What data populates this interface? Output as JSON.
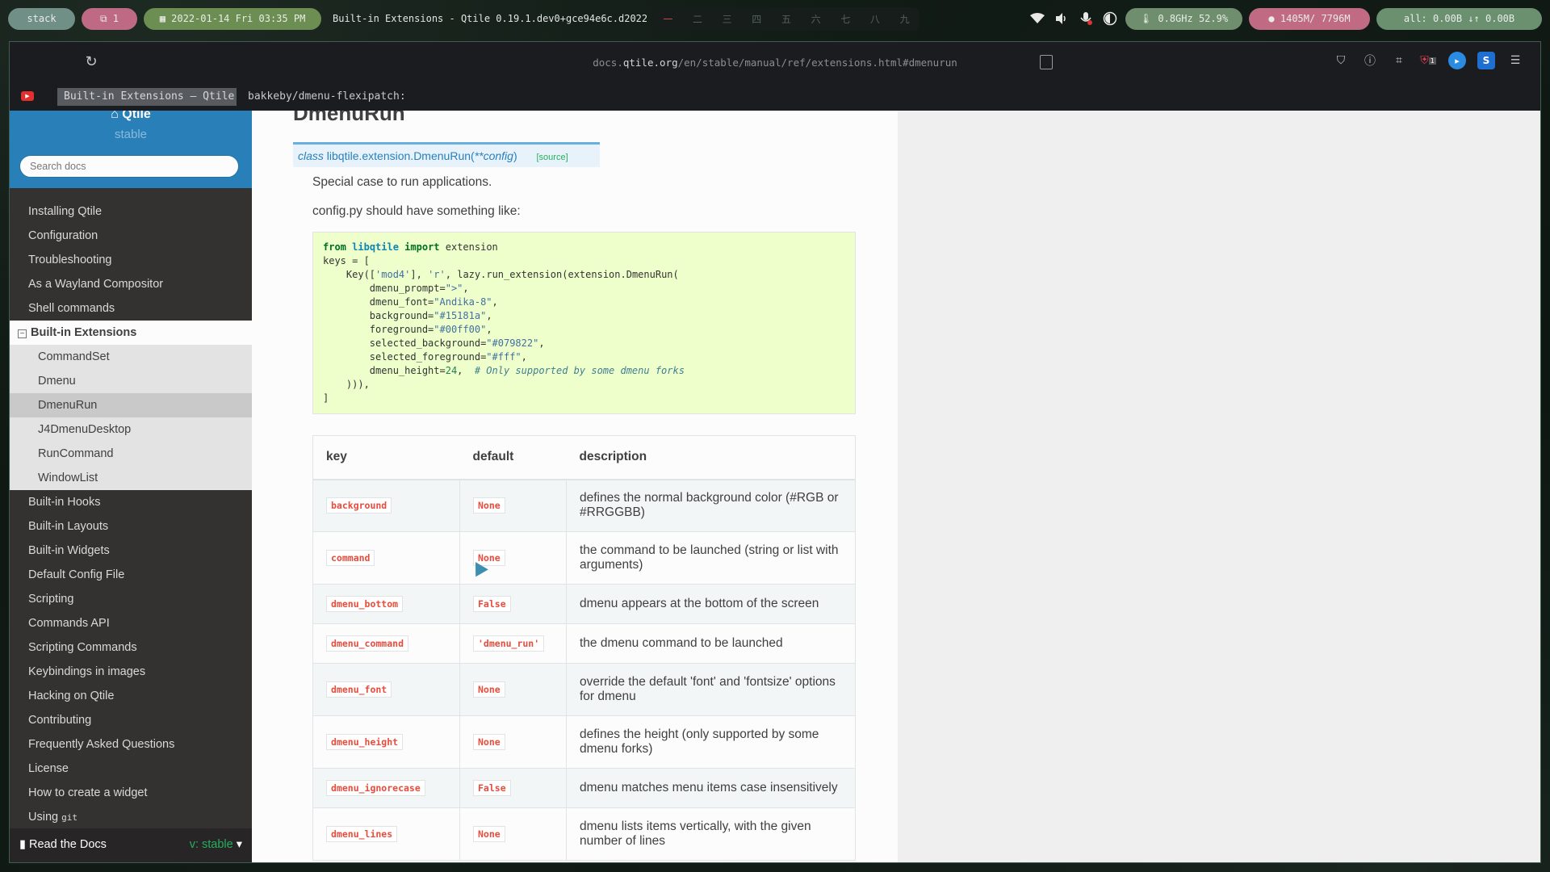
{
  "topbar": {
    "layout": "stack",
    "windows": "1",
    "clock": "2022-01-14 Fri 03:35 PM",
    "window_title": "Built-in Extensions - Qtile 0.19.1.dev0+gce94e6c.d2022",
    "groups": [
      "一",
      "二",
      "三",
      "四",
      "五",
      "六",
      "七",
      "八",
      "九"
    ],
    "cpu": "0.8GHz 52.9%",
    "memory": "1405M/ 7796M",
    "net": "all:  0.00B ↓↑  0.00B"
  },
  "browser": {
    "url_domain": "docs.qtile.org",
    "url_path": "/en/stable/manual/ref/extensions.html#dmenurun",
    "url_prefix": "docs.",
    "url_domain_main": "qtile.org",
    "tabs": [
      {
        "label": "Built-in Extensions — Qtile"
      },
      {
        "label": "bakkeby/dmenu-flexipatch:"
      }
    ],
    "extension_badge": "1"
  },
  "sidebar": {
    "project": "Qtile",
    "version": "stable",
    "search_placeholder": "Search docs",
    "items_top": [
      "Installing Qtile",
      "Configuration",
      "Troubleshooting",
      "As a Wayland Compositor",
      "Shell commands"
    ],
    "current": "Built-in Extensions",
    "sub_items": [
      "CommandSet",
      "Dmenu",
      "DmenuRun",
      "J4DmenuDesktop",
      "RunCommand",
      "WindowList"
    ],
    "active_sub": "DmenuRun",
    "items_bottom": [
      "Built-in Hooks",
      "Built-in Layouts",
      "Built-in Widgets",
      "Default Config File",
      "Scripting",
      "Commands API",
      "Scripting Commands",
      "Keybindings in images",
      "Hacking on Qtile",
      "Contributing",
      "Frequently Asked Questions",
      "License",
      "How to create a widget"
    ],
    "using_prefix": "Using",
    "using_code": "git",
    "footer_label": "Read the Docs",
    "footer_version": "v: stable"
  },
  "content": {
    "heading": "DmenuRun",
    "sig_class": "class",
    "sig_name": "libqtile.extension.DmenuRun(",
    "sig_param": "**config",
    "sig_close": ")",
    "sig_source": "[source]",
    "para1": "Special case to run applications.",
    "para2": "config.py should have something like:",
    "table": {
      "headers": [
        "key",
        "default",
        "description"
      ],
      "rows": [
        {
          "key": "background",
          "default": "None",
          "description": "defines the normal background color (#RGB or #RRGGBB)"
        },
        {
          "key": "command",
          "default": "None",
          "description": "the command to be launched (string or list with arguments)"
        },
        {
          "key": "dmenu_bottom",
          "default": "False",
          "description": "dmenu appears at the bottom of the screen"
        },
        {
          "key": "dmenu_command",
          "default": "'dmenu_run'",
          "description": "the dmenu command to be launched"
        },
        {
          "key": "dmenu_font",
          "default": "None",
          "description": "override the default 'font' and 'fontsize' options for dmenu"
        },
        {
          "key": "dmenu_height",
          "default": "None",
          "description": "defines the height (only supported by some dmenu forks)"
        },
        {
          "key": "dmenu_ignorecase",
          "default": "False",
          "description": "dmenu matches menu items case insensitively"
        },
        {
          "key": "dmenu_lines",
          "default": "None",
          "description": "dmenu lists items vertically, with the given number of lines"
        }
      ]
    }
  },
  "icons": {
    "reload": "reload-icon",
    "home": "home-icon",
    "book": "book-icon"
  },
  "colors": {
    "rtd_blue": "#2980b9",
    "code_bg": "#eeffcc",
    "literal_red": "#e74c3c"
  }
}
